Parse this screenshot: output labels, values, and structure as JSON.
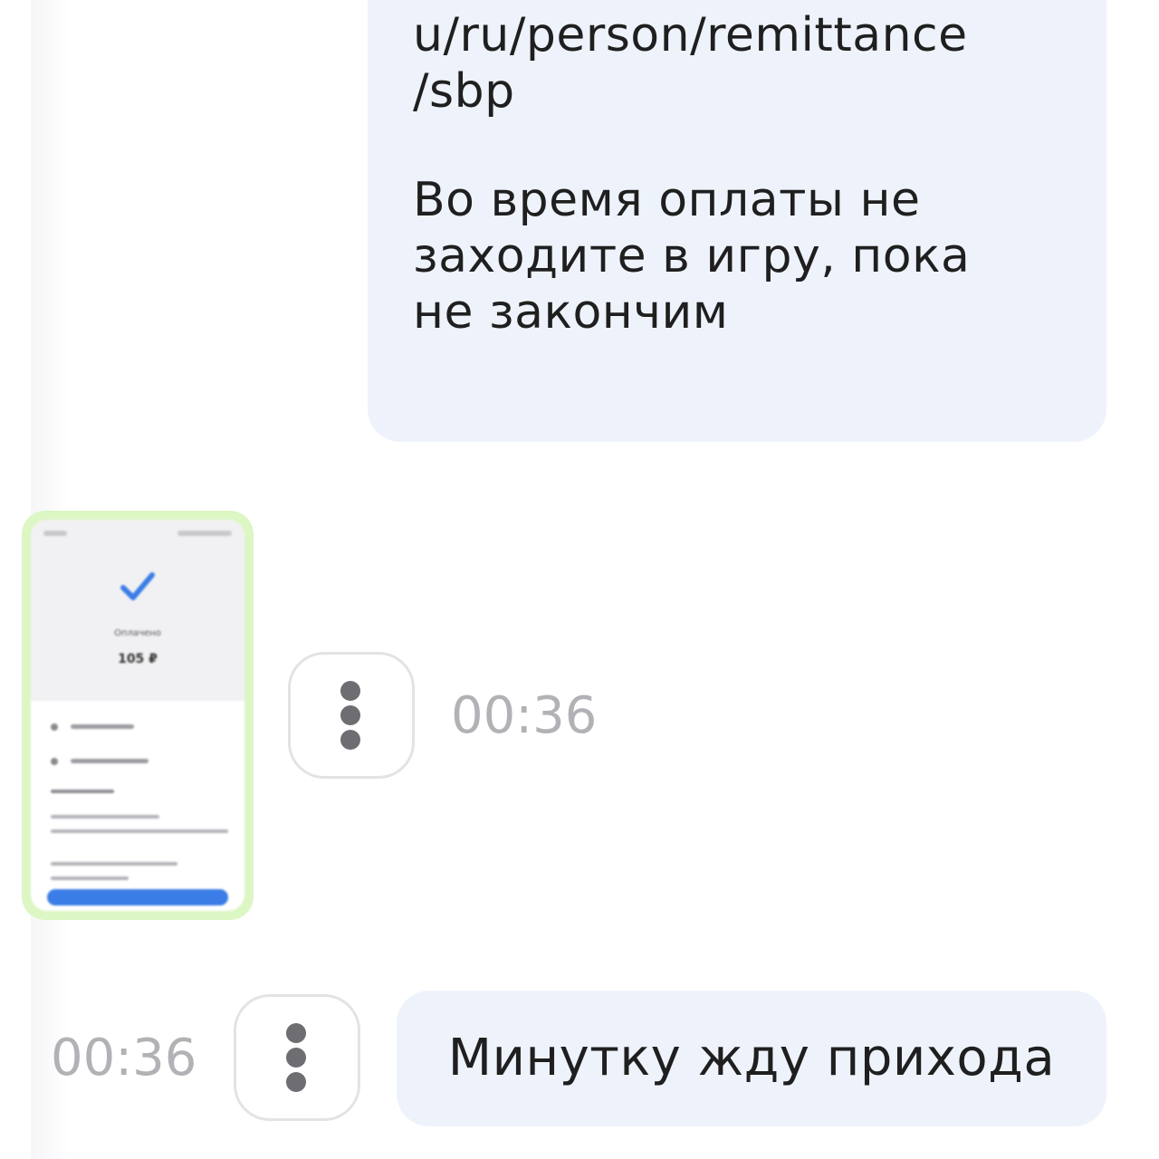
{
  "chat": {
    "incoming_message": {
      "link_lines": [
        "u/ru/person/remittance",
        "/sbp"
      ],
      "text_lines": [
        "Во время оплаты не",
        "заходите в игру, пока",
        "не закончим"
      ]
    },
    "image_message": {
      "thumbnail": {
        "icon": "checkmark-icon",
        "amount_label": "Оплачено",
        "amount": "105 ₽"
      },
      "timestamp": "00:36"
    },
    "outgoing_message": {
      "text": "Минутку жду прихода",
      "timestamp": "00:36"
    }
  },
  "colors": {
    "incoming_bubble": "#eef3fb",
    "image_border": "#dcf6c4",
    "timestamp": "#b2b2b6",
    "accent_check": "#3b7de6"
  }
}
